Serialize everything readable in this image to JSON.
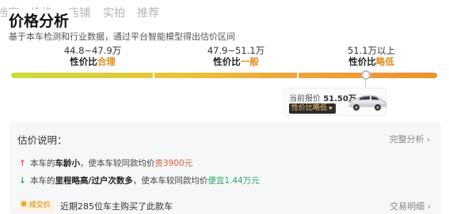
{
  "tabs": [
    "档案",
    "价格",
    "店铺",
    "实拍",
    "推荐"
  ],
  "header": {
    "title": "价格分析",
    "subtitle": "基于本车检测和行业数据，通过平台智能模型得出估价区间"
  },
  "ranges": [
    {
      "price": "44.8~47.9万",
      "prefix": "性价比",
      "level": "合理"
    },
    {
      "price": "47.9~51.1万",
      "prefix": "性价比",
      "level": "一般"
    },
    {
      "price": "51.1万以上",
      "prefix": "性价比",
      "level": "略低"
    }
  ],
  "callout": {
    "label": "当前报价",
    "value": "51.50万",
    "badge": "性价比略低",
    "badge_arrow": "▸"
  },
  "explain": {
    "title": "估价说明：",
    "more": "完整分析",
    "chevron": "›",
    "reasons": [
      {
        "arrow": "↑",
        "pre": "本车的",
        "key": "车龄小",
        "mid": "，使本车较同款均价",
        "effect": "贵3900元"
      },
      {
        "arrow": "↓",
        "pre": "本车的",
        "key": "里程略高/过户次数多",
        "mid": "，使本车较同款均价",
        "effect": "便宜1.44万元"
      }
    ]
  },
  "deal": {
    "badge": "成交价",
    "text": "近期285位车主购买了此款车",
    "more": "交易明细",
    "chevron": "›"
  },
  "colors": {
    "accent": "#e58a1a",
    "up": "#e05a3a",
    "down": "#2fa56b"
  }
}
